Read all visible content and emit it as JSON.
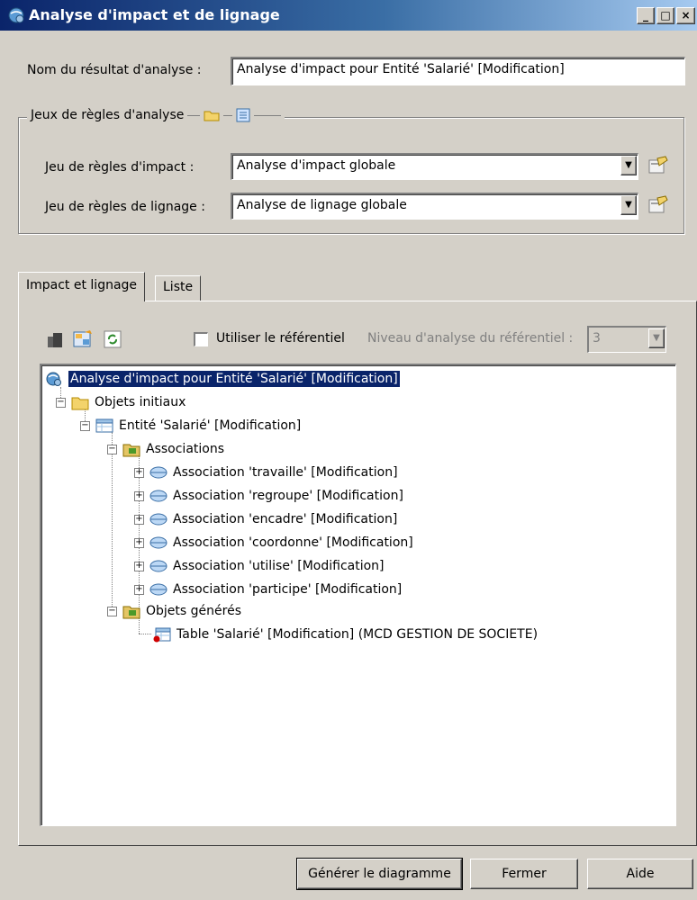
{
  "window": {
    "title": "Analyse d'impact et de lignage",
    "controls": {
      "minimize": "_",
      "maximize": "□",
      "close": "×"
    }
  },
  "result_name": {
    "label": "Nom du résultat d'analyse :",
    "value": "Analyse d'impact pour Entité 'Salarié' [Modification]"
  },
  "rule_sets": {
    "group_title": "Jeux de règles d'analyse",
    "impact": {
      "label": "Jeu de règles d'impact :",
      "value": "Analyse d'impact globale"
    },
    "lineage": {
      "label": "Jeu de règles de lignage :",
      "value": "Analyse de lignage globale"
    }
  },
  "tabs": [
    {
      "label": "Impact et lignage",
      "active": true
    },
    {
      "label": "Liste",
      "active": false
    }
  ],
  "options": {
    "use_repository_label": "Utiliser le référentiel",
    "use_repository_checked": false,
    "repo_level_label": "Niveau d'analyse du référentiel :",
    "repo_level_value": "3"
  },
  "tree": {
    "root": "Analyse d'impact pour Entité 'Salarié' [Modification]",
    "initial_objects": "Objets initiaux",
    "entity": "Entité 'Salarié' [Modification]",
    "associations_folder": "Associations",
    "associations": [
      "Association 'travaille' [Modification]",
      "Association 'regroupe' [Modification]",
      "Association 'encadre' [Modification]",
      "Association 'coordonne' [Modification]",
      "Association 'utilise' [Modification]",
      "Association 'participe' [Modification]"
    ],
    "generated_folder": "Objets générés",
    "generated_table": "Table 'Salarié' [Modification] (MCD GESTION DE SOCIETE)"
  },
  "buttons": {
    "generate": "Générer le diagramme",
    "close": "Fermer",
    "help": "Aide"
  },
  "colors": {
    "titlebar_start": "#0a246a",
    "titlebar_end": "#a6caf0",
    "selection": "#0a246a",
    "face": "#d4d0c8"
  }
}
